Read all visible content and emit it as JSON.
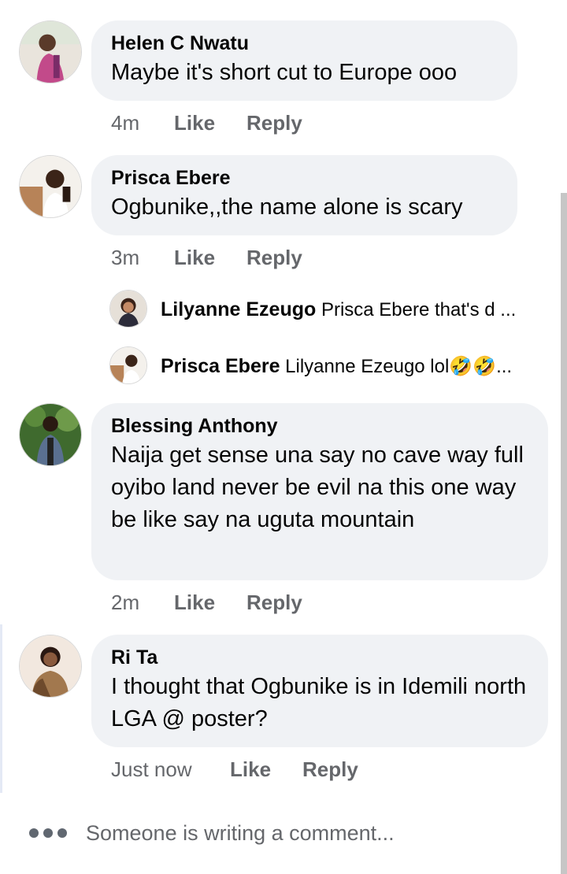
{
  "comments": [
    {
      "author": "Helen C Nwatu",
      "text": "Maybe it's short cut to Europe ooo",
      "time": "4m",
      "like": "Like",
      "reply": "Reply"
    },
    {
      "author": "Prisca Ebere",
      "text": "Ogbunike,,the name alone is scary",
      "time": "3m",
      "like": "Like",
      "reply": "Reply",
      "replies": [
        {
          "author": "Lilyanne Ezeugo",
          "text": "Prisca Ebere that's d ..."
        },
        {
          "author": "Prisca Ebere",
          "text": "Lilyanne Ezeugo lol🤣🤣..."
        }
      ]
    },
    {
      "author": "Blessing Anthony",
      "text": "Naija get sense una say no cave way full  oyibo land never be evil na this one way be like say na uguta mountain",
      "time": "2m",
      "like": "Like",
      "reply": "Reply"
    },
    {
      "author": "Ri Ta",
      "text": "I thought that Ogbunike is in Idemili north LGA @ poster?",
      "time": "Just now",
      "like": "Like",
      "reply": "Reply"
    }
  ],
  "typing_indicator": "Someone is writing a comment..."
}
